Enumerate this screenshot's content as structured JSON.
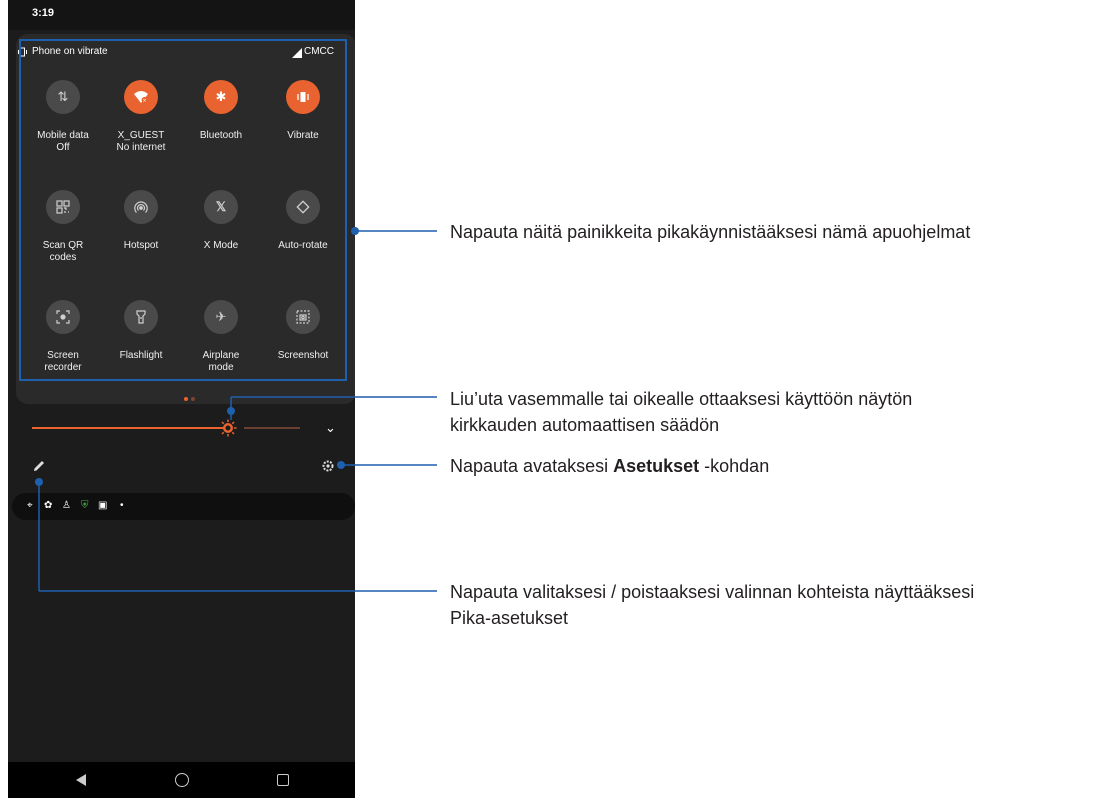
{
  "status_bar": {
    "time": "3:19"
  },
  "quick_settings": {
    "vibrate_status": "Phone on vibrate",
    "carrier": "CMCC",
    "tiles": [
      {
        "label": "Mobile data\nOff",
        "icon": "mobile-data-icon",
        "active": false
      },
      {
        "label": "X_GUEST\nNo internet",
        "icon": "wifi-icon",
        "active": true
      },
      {
        "label": "Bluetooth",
        "icon": "bluetooth-icon",
        "active": true
      },
      {
        "label": "Vibrate",
        "icon": "vibrate-icon",
        "active": true
      },
      {
        "label": "Scan QR\ncodes",
        "icon": "qr-code-icon",
        "active": false
      },
      {
        "label": "Hotspot",
        "icon": "hotspot-icon",
        "active": false
      },
      {
        "label": "X Mode",
        "icon": "x-mode-icon",
        "active": false
      },
      {
        "label": "Auto-rotate",
        "icon": "auto-rotate-icon",
        "active": false
      },
      {
        "label": "Screen\nrecorder",
        "icon": "screen-recorder-icon",
        "active": false
      },
      {
        "label": "Flashlight",
        "icon": "flashlight-icon",
        "active": false
      },
      {
        "label": "Airplane\nmode",
        "icon": "airplane-icon",
        "active": false
      },
      {
        "label": "Screenshot",
        "icon": "screenshot-icon",
        "active": false
      }
    ],
    "page_indicator": {
      "pages": 2,
      "current": 1
    },
    "brightness_level": 0.74
  },
  "colors": {
    "accent": "#e8632f",
    "callout_line": "#1e5fae",
    "panel": "#2a2a2a",
    "background": "#1c1c1c"
  },
  "callouts": {
    "tiles": "Napauta näitä painikkeita pikakäynnistääksesi nämä apuohjelmat",
    "brightness_line1": "Liu’uta vasemmalle tai oikealle ottaaksesi käyttöön näytön",
    "brightness_line2": "kirkkauden automaattisen säädön",
    "settings_prefix": "Napauta avataksesi ",
    "settings_bold": "Asetukset",
    "settings_suffix": " -kohdan",
    "edit_line1": "Napauta valitaksesi / poistaaksesi valinnan kohteista näyttääksesi",
    "edit_line2": "Pika-asetukset"
  }
}
